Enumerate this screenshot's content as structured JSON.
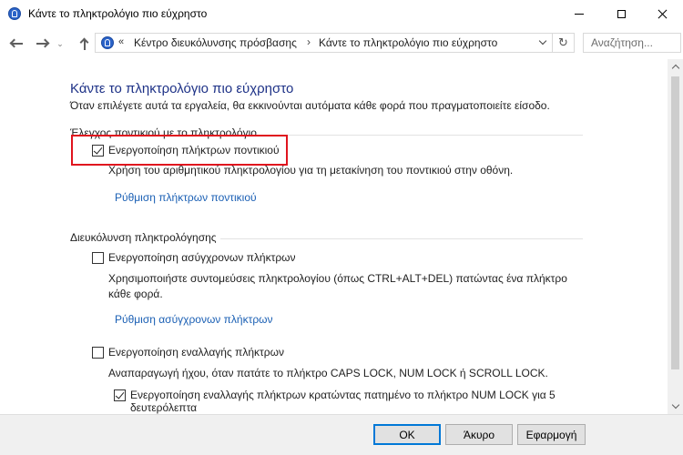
{
  "window": {
    "title": "Κάντε το πληκτρολόγιο πιο εύχρηστο"
  },
  "nav": {
    "recent_glyph": "⌄",
    "address_chevron": "«",
    "breadcrumb": [
      "Κέντρο διευκόλυνσης πρόσβασης",
      "Κάντε το πληκτρολόγιο πιο εύχρηστο"
    ],
    "breadcrumb_separator": "›",
    "refresh_glyph": "↻",
    "search_placeholder": "Αναζήτηση..."
  },
  "page": {
    "title": "Κάντε το πληκτρολόγιο πιο εύχρηστο",
    "subtitle": "Όταν επιλέγετε αυτά τα εργαλεία, θα εκκινούνται αυτόματα κάθε φορά που πραγματοποιείτε είσοδο."
  },
  "mouse_section": {
    "label": "Έλεγχος ποντικιού με το πληκτρολόγιο",
    "mouse_keys": {
      "label": "Ενεργοποίηση πλήκτρων ποντικιού",
      "checked": true,
      "description": "Χρήση του αριθμητικού πληκτρολογίου για τη μετακίνηση του ποντικιού στην οθόνη.",
      "link": "Ρύθμιση πλήκτρων ποντικιού"
    }
  },
  "typing_section": {
    "label": "Διευκόλυνση πληκτρολόγησης",
    "sticky_keys": {
      "label": "Ενεργοποίηση ασύγχρονων πλήκτρων",
      "checked": false,
      "description_line1": "Χρησιμοποιήστε συντομεύσεις πληκτρολογίου (όπως CTRL+ALT+DEL) πατώντας ένα πλήκτρο",
      "description_line2": "κάθε φορά.",
      "link": "Ρύθμιση ασύγχρονων πλήκτρων"
    },
    "toggle_keys": {
      "label": "Ενεργοποίηση εναλλαγής πλήκτρων",
      "checked": false,
      "description": "Αναπαραγωγή ήχου, όταν πατάτε το πλήκτρο CAPS LOCK, NUM LOCK ή SCROLL LOCK.",
      "sub_option": {
        "label_line1": "Ενεργοποίηση εναλλαγής πλήκτρων κρατώντας πατημένο το πλήκτρο NUM LOCK για 5",
        "label_line2": "δευτερόλεπτα",
        "checked": true
      }
    }
  },
  "buttons": {
    "ok": "OK",
    "cancel": "Άκυρο",
    "apply": "Εφαρμογή"
  },
  "colors": {
    "title_blue": "#1e3287",
    "link_blue": "#1a5fb4",
    "highlight_red": "#e0141e"
  }
}
